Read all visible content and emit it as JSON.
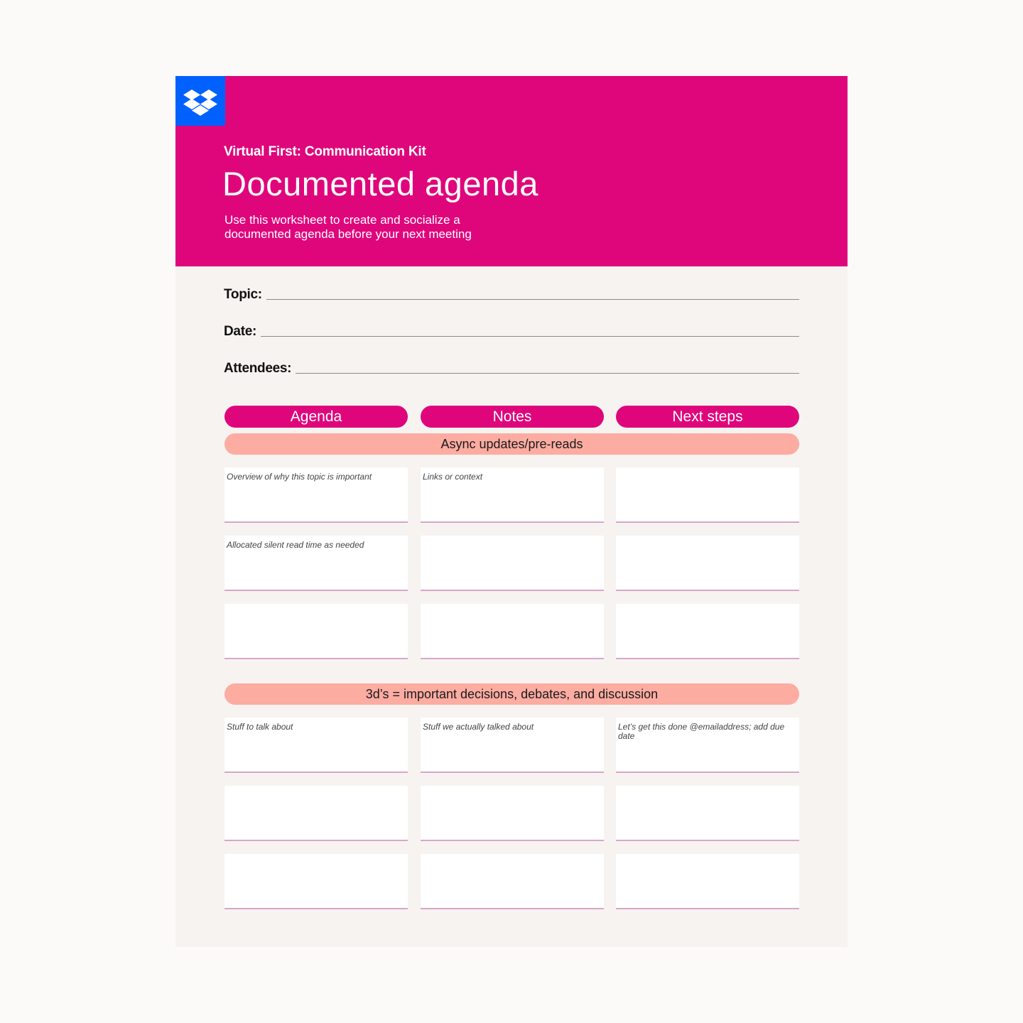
{
  "brand": {
    "logo_icon": "dropbox-logo-icon",
    "logo_bg": "#0061fe",
    "accent": "#df067c",
    "band_color": "#fdaca2"
  },
  "header": {
    "kicker": "Virtual First: Communication Kit",
    "title": "Documented agenda",
    "subtitle": "Use this worksheet to create and socialize a documented agenda before your next meeting"
  },
  "fields": [
    {
      "label": "Topic:",
      "value": ""
    },
    {
      "label": "Date:",
      "value": ""
    },
    {
      "label": "Attendees:",
      "value": ""
    }
  ],
  "columns": [
    "Agenda",
    "Notes",
    "Next steps"
  ],
  "sections": [
    {
      "title": "Async updates/pre-reads",
      "rows": [
        [
          "Overview of why this topic is important",
          "Links or context",
          ""
        ],
        [
          "Allocated silent read time as needed",
          "",
          ""
        ],
        [
          "",
          "",
          ""
        ]
      ]
    },
    {
      "title": "3d’s = important decisions, debates, and discussion",
      "rows": [
        [
          "Stuff to talk about",
          "Stuff we actually talked about",
          "Let’s get this done @emailaddress; add due date"
        ],
        [
          "",
          "",
          ""
        ],
        [
          "",
          "",
          ""
        ]
      ]
    }
  ]
}
